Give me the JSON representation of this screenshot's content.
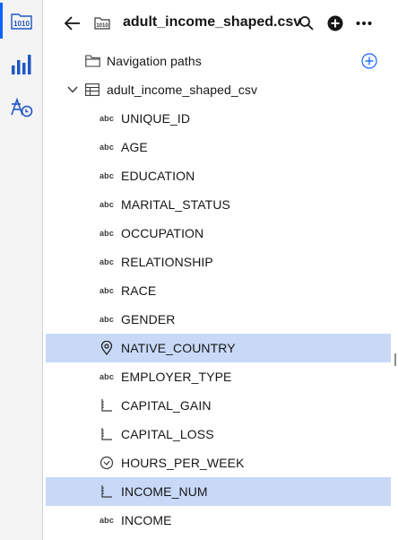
{
  "header": {
    "title": "adult_income_shaped.csv"
  },
  "tree": {
    "navigation_paths_label": "Navigation paths",
    "table_name": "adult_income_shaped_csv",
    "abc_glyph": "abc",
    "columns": [
      {
        "name": "UNIQUE_ID",
        "type_icon": "abc-text-icon",
        "selected": false
      },
      {
        "name": "AGE",
        "type_icon": "abc-text-icon",
        "selected": false
      },
      {
        "name": "EDUCATION",
        "type_icon": "abc-text-icon",
        "selected": false
      },
      {
        "name": "MARITAL_STATUS",
        "type_icon": "abc-text-icon",
        "selected": false
      },
      {
        "name": "OCCUPATION",
        "type_icon": "abc-text-icon",
        "selected": false
      },
      {
        "name": "RELATIONSHIP",
        "type_icon": "abc-text-icon",
        "selected": false
      },
      {
        "name": "RACE",
        "type_icon": "abc-text-icon",
        "selected": false
      },
      {
        "name": "GENDER",
        "type_icon": "abc-text-icon",
        "selected": false
      },
      {
        "name": "NATIVE_COUNTRY",
        "type_icon": "location-pin-icon",
        "selected": true
      },
      {
        "name": "EMPLOYER_TYPE",
        "type_icon": "abc-text-icon",
        "selected": false
      },
      {
        "name": "CAPITAL_GAIN",
        "type_icon": "measure-ruler-icon",
        "selected": false
      },
      {
        "name": "CAPITAL_LOSS",
        "type_icon": "measure-ruler-icon",
        "selected": false
      },
      {
        "name": "HOURS_PER_WEEK",
        "type_icon": "clock-icon",
        "selected": false
      },
      {
        "name": "INCOME_NUM",
        "type_icon": "measure-ruler-icon",
        "selected": true
      },
      {
        "name": "INCOME",
        "type_icon": "abc-text-icon",
        "selected": false
      }
    ]
  },
  "colors": {
    "accent": "#0f62fe",
    "selected_row": "#c7d9f7",
    "rail_bg": "#f4f4f4",
    "icon_blue": "#1f57c3"
  }
}
